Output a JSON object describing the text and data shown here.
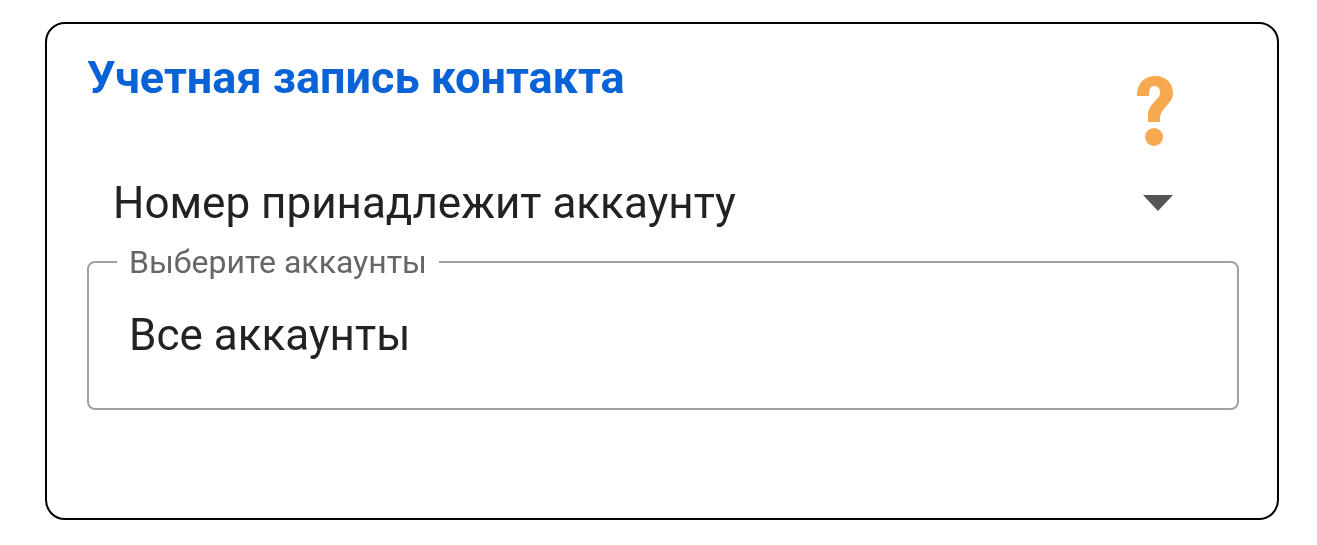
{
  "card": {
    "title": "Учетная запись контакта",
    "dropdown": {
      "value": "Номер принадлежит аккаунту"
    },
    "accounts_field": {
      "label": "Выберите аккаунты",
      "value": "Все аккаунты"
    }
  }
}
